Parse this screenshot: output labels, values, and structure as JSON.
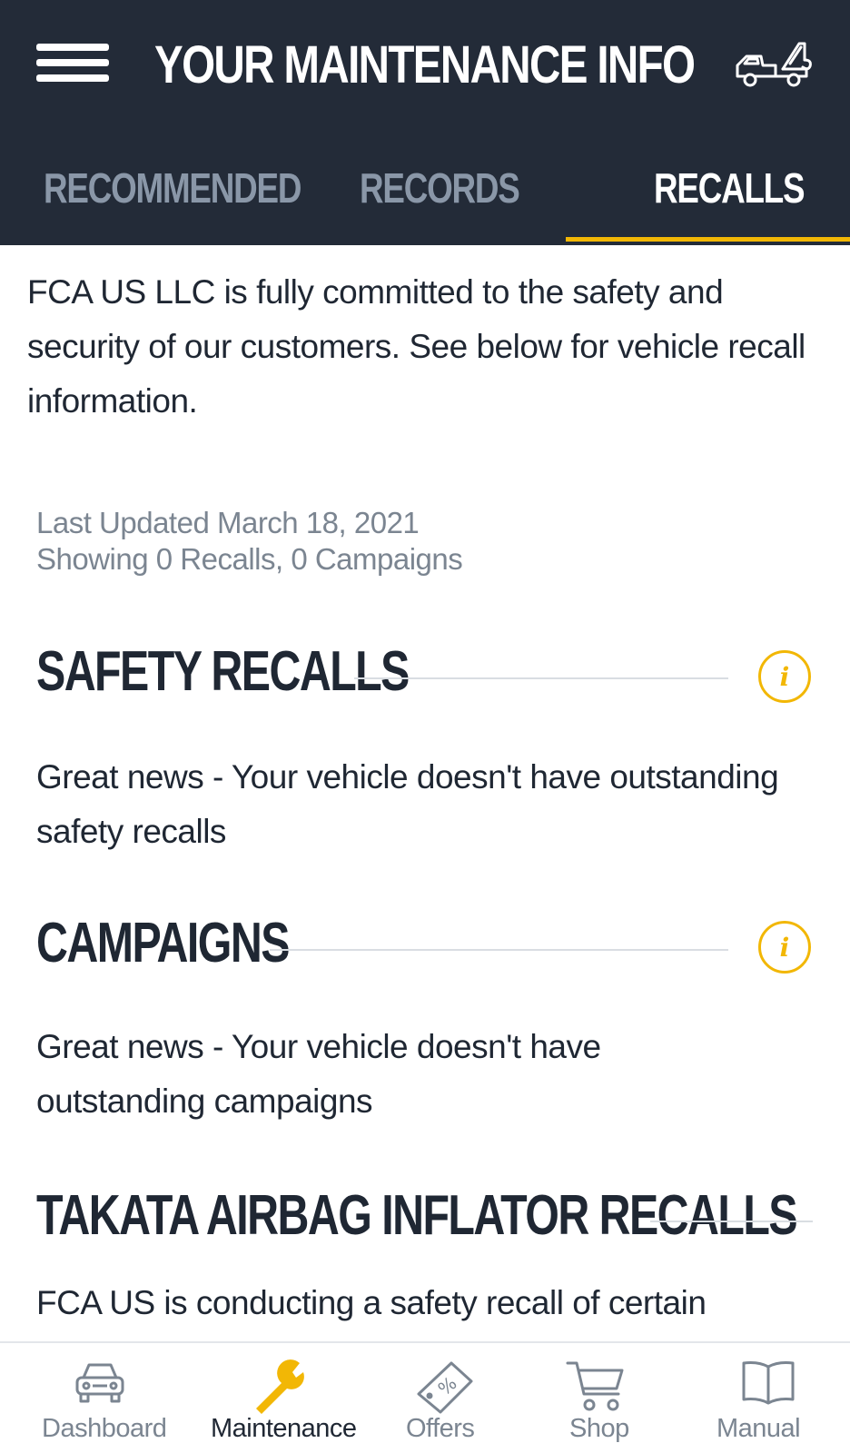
{
  "header": {
    "title": "YOUR MAINTENANCE INFO",
    "menu_icon": "hamburger-menu-icon",
    "action_icon": "tow-truck-icon"
  },
  "tabs": [
    {
      "label": "RECOMMENDED",
      "active": false
    },
    {
      "label": "RECORDS",
      "active": false
    },
    {
      "label": "RECALLS",
      "active": true
    }
  ],
  "intro": "FCA US LLC is fully committed to the safety and security of our customers. See below for vehicle recall information.",
  "meta": {
    "last_updated": "Last Updated March 18, 2021",
    "showing": "Showing 0 Recalls, 0 Campaigns"
  },
  "sections": [
    {
      "title": "SAFETY RECALLS",
      "body": "Great news - Your vehicle doesn't have outstanding safety recalls",
      "info_icon": "info-icon"
    },
    {
      "title": "CAMPAIGNS",
      "body": "Great news - Your vehicle doesn't have outstanding campaigns",
      "info_icon": "info-icon"
    },
    {
      "title": "TAKATA AIRBAG INFLATOR RECALLS",
      "body": "FCA US is conducting a safety recall of certain"
    }
  ],
  "bottom_nav": [
    {
      "label": "Dashboard",
      "icon": "car-icon",
      "active": false
    },
    {
      "label": "Maintenance",
      "icon": "wrench-icon",
      "active": true
    },
    {
      "label": "Offers",
      "icon": "percent-tag-icon",
      "active": false
    },
    {
      "label": "Shop",
      "icon": "shopping-cart-icon",
      "active": false
    },
    {
      "label": "Manual",
      "icon": "open-book-icon",
      "active": false
    }
  ],
  "colors": {
    "header_bg": "#232b38",
    "accent": "#f2b705",
    "text": "#1f2733",
    "muted": "#7b8591",
    "tab_inactive": "#8a97a8"
  }
}
